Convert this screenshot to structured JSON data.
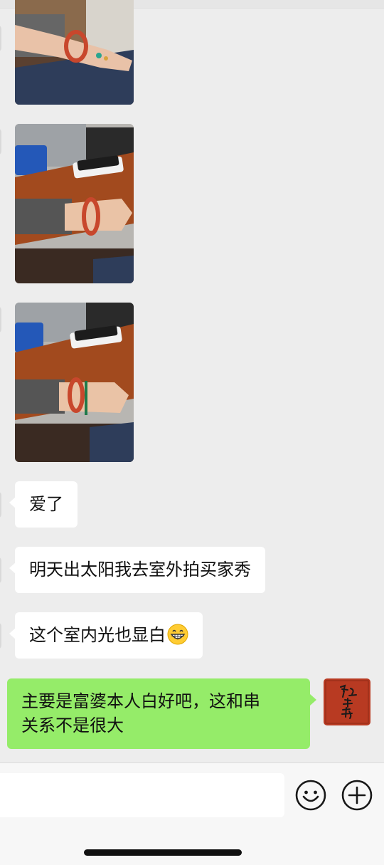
{
  "messages": [
    {
      "type": "image",
      "from": "them",
      "description": "photo"
    },
    {
      "type": "image",
      "from": "them",
      "description": "photo"
    },
    {
      "type": "image",
      "from": "them",
      "description": "photo"
    },
    {
      "type": "text",
      "from": "them",
      "text": "爱了"
    },
    {
      "type": "text",
      "from": "them",
      "text": "明天出太阳我去室外拍买家秀"
    },
    {
      "type": "text",
      "from": "them",
      "text": "这个室内光也显白",
      "emoji": "grinning-face-icon"
    },
    {
      "type": "text",
      "from": "me",
      "line1": "主要是富婆本人白好吧，这和串",
      "line2": "关系不是很大"
    }
  ],
  "input_bar": {
    "value": "",
    "icons": [
      "emoji-icon",
      "plus-icon"
    ]
  },
  "colors": {
    "background": "#ededed",
    "incoming_bubble": "#ffffff",
    "outgoing_bubble": "#95ec69",
    "avatar_red": "#b83a22"
  }
}
